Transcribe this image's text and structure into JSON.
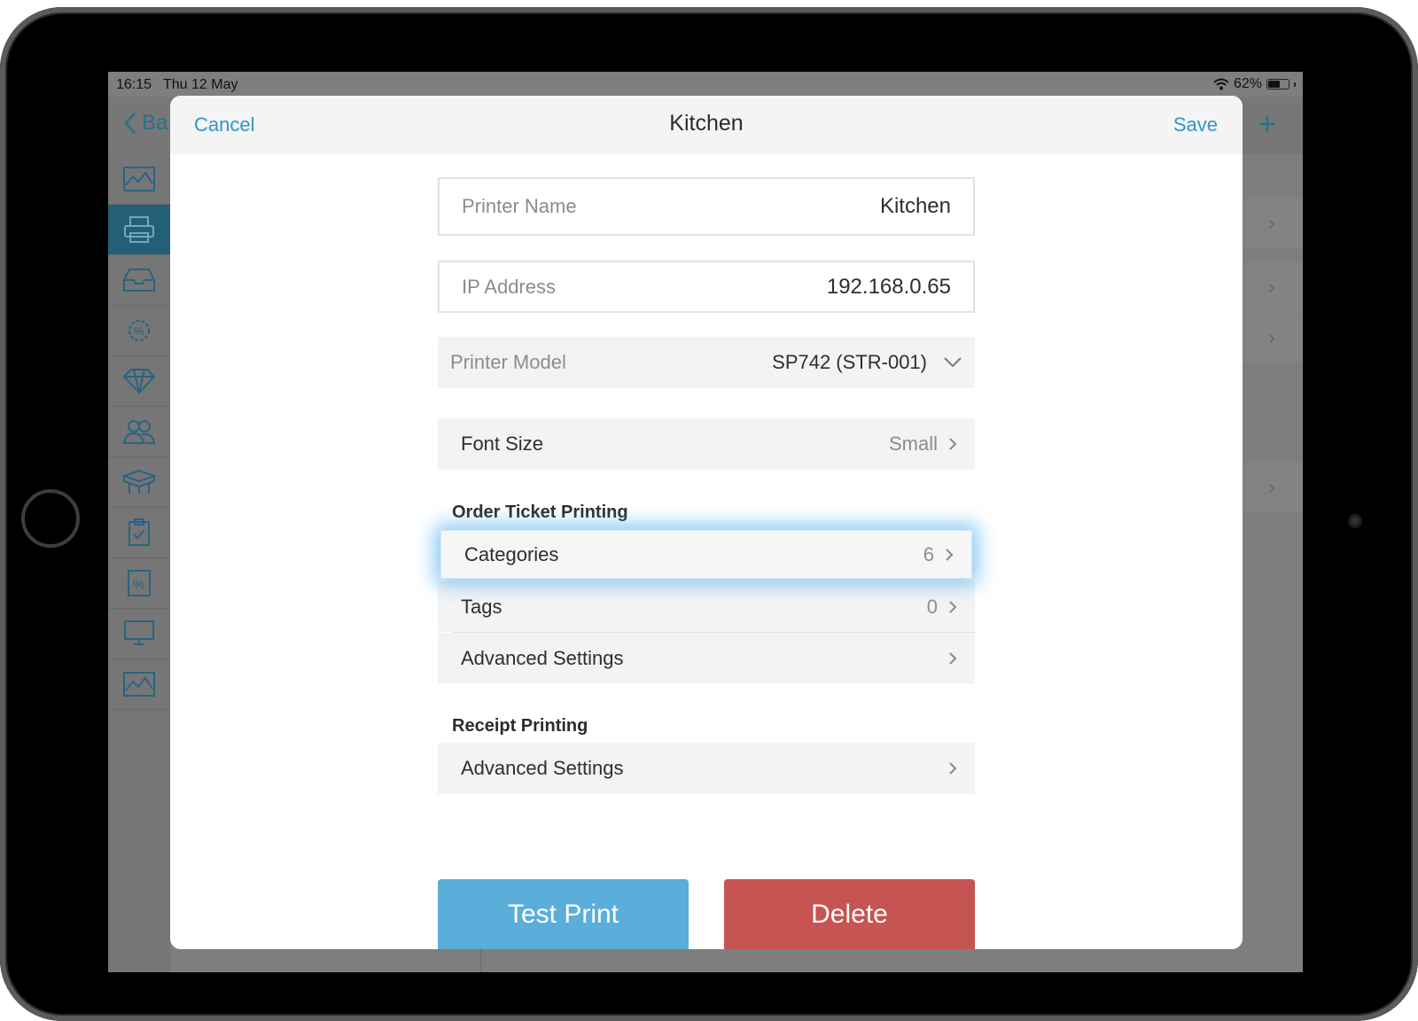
{
  "status_bar": {
    "time": "16:15",
    "date": "Thu 12 May",
    "battery": "62%",
    "battery_level": 0.62
  },
  "background": {
    "back_label": "Ba",
    "add_icon": "plus-icon"
  },
  "modal": {
    "title": "Kitchen",
    "cancel_label": "Cancel",
    "save_label": "Save",
    "printer_name": {
      "label": "Printer Name",
      "value": "Kitchen"
    },
    "ip_address": {
      "label": "IP Address",
      "value": "192.168.0.65"
    },
    "printer_model": {
      "label": "Printer Model",
      "value": "SP742 (STR-001)"
    },
    "font_size": {
      "label": "Font Size",
      "value": "Small"
    },
    "order_ticket_section": {
      "title": "Order Ticket Printing",
      "rows": [
        {
          "label": "Categories",
          "value": "6"
        },
        {
          "label": "Tags",
          "value": "0"
        },
        {
          "label": "Advanced Settings",
          "value": ""
        }
      ]
    },
    "receipt_section": {
      "title": "Receipt Printing",
      "rows": [
        {
          "label": "Advanced Settings",
          "value": ""
        }
      ]
    },
    "test_print_label": "Test Print",
    "delete_label": "Delete"
  },
  "colors": {
    "accent": "#2f97c9",
    "test_print": "#5aaed9",
    "delete": "#c65453",
    "sidebar_active": "#245f78"
  }
}
